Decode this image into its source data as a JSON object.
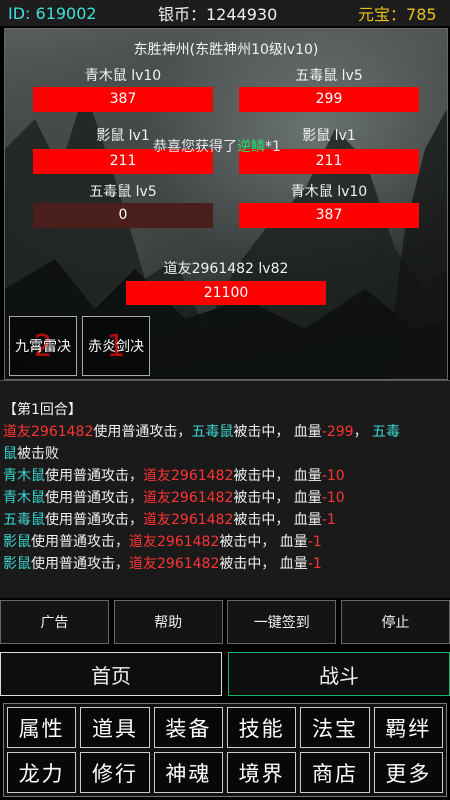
{
  "topbar": {
    "id_text": "ID: 619002",
    "silver_text": "银币：1244930",
    "yuanbao_label": "元宝：",
    "yuanbao_value": "785"
  },
  "battle": {
    "title": "东胜神州(东胜神州10级lv10)",
    "enemies": [
      {
        "name": "青木鼠  lv10",
        "hp": "387",
        "dead": false
      },
      {
        "name": "五毒鼠  lv5",
        "hp": "299",
        "dead": false
      },
      {
        "name": "影鼠  lv1",
        "hp": "211",
        "dead": false
      },
      {
        "name": "影鼠  lv1",
        "hp": "211",
        "dead": false
      },
      {
        "name": "五毒鼠  lv5",
        "hp": "0",
        "dead": true
      },
      {
        "name": "青木鼠  lv10",
        "hp": "387",
        "dead": false
      }
    ],
    "congrats_prefix": "恭喜您获得了",
    "congrats_item": "逆鳞",
    "congrats_suffix": "*1",
    "player": {
      "name": "道友2961482  lv82",
      "hp": "21100"
    },
    "skills": [
      {
        "name": "九霄雷决",
        "cooldown": "2"
      },
      {
        "name": "赤炎剑决",
        "cooldown": "1"
      }
    ]
  },
  "log": {
    "round_title": "【第1回合】",
    "lines": [
      [
        {
          "t": "道友2961482",
          "c": "red"
        },
        {
          "t": "使用普通攻击，",
          "c": "white"
        },
        {
          "t": "五毒鼠",
          "c": "cyan"
        },
        {
          "t": "被击中，  血量",
          "c": "white"
        },
        {
          "t": "-299",
          "c": "red"
        },
        {
          "t": "，  ",
          "c": "white"
        },
        {
          "t": "五毒",
          "c": "cyan"
        }
      ],
      [
        {
          "t": "鼠",
          "c": "cyan"
        },
        {
          "t": "被击败",
          "c": "white"
        }
      ],
      [
        {
          "t": "青木鼠",
          "c": "cyan"
        },
        {
          "t": "使用普通攻击，",
          "c": "white"
        },
        {
          "t": "道友2961482",
          "c": "red"
        },
        {
          "t": "被击中，  血量",
          "c": "white"
        },
        {
          "t": "-10",
          "c": "red"
        }
      ],
      [
        {
          "t": "青木鼠",
          "c": "cyan"
        },
        {
          "t": "使用普通攻击，",
          "c": "white"
        },
        {
          "t": "道友2961482",
          "c": "red"
        },
        {
          "t": "被击中，  血量",
          "c": "white"
        },
        {
          "t": "-10",
          "c": "red"
        }
      ],
      [
        {
          "t": "五毒鼠",
          "c": "cyan"
        },
        {
          "t": "使用普通攻击，",
          "c": "white"
        },
        {
          "t": "道友2961482",
          "c": "red"
        },
        {
          "t": "被击中，  血量",
          "c": "white"
        },
        {
          "t": "-1",
          "c": "red"
        }
      ],
      [
        {
          "t": "影鼠",
          "c": "cyan"
        },
        {
          "t": "使用普通攻击，",
          "c": "white"
        },
        {
          "t": "道友2961482",
          "c": "red"
        },
        {
          "t": "被击中，  血量",
          "c": "white"
        },
        {
          "t": "-1",
          "c": "red"
        }
      ],
      [
        {
          "t": "影鼠",
          "c": "cyan"
        },
        {
          "t": "使用普通攻击，",
          "c": "white"
        },
        {
          "t": "道友2961482",
          "c": "red"
        },
        {
          "t": "被击中，  血量",
          "c": "white"
        },
        {
          "t": "-1",
          "c": "red"
        }
      ]
    ]
  },
  "actions": {
    "ad": "广告",
    "help": "帮助",
    "signin": "一键签到",
    "stop": "停止"
  },
  "nav": {
    "home": "首页",
    "battle": "战斗"
  },
  "menu": [
    "属性",
    "道具",
    "装备",
    "技能",
    "法宝",
    "羁绊",
    "龙力",
    "修行",
    "神魂",
    "境界",
    "商店",
    "更多"
  ]
}
